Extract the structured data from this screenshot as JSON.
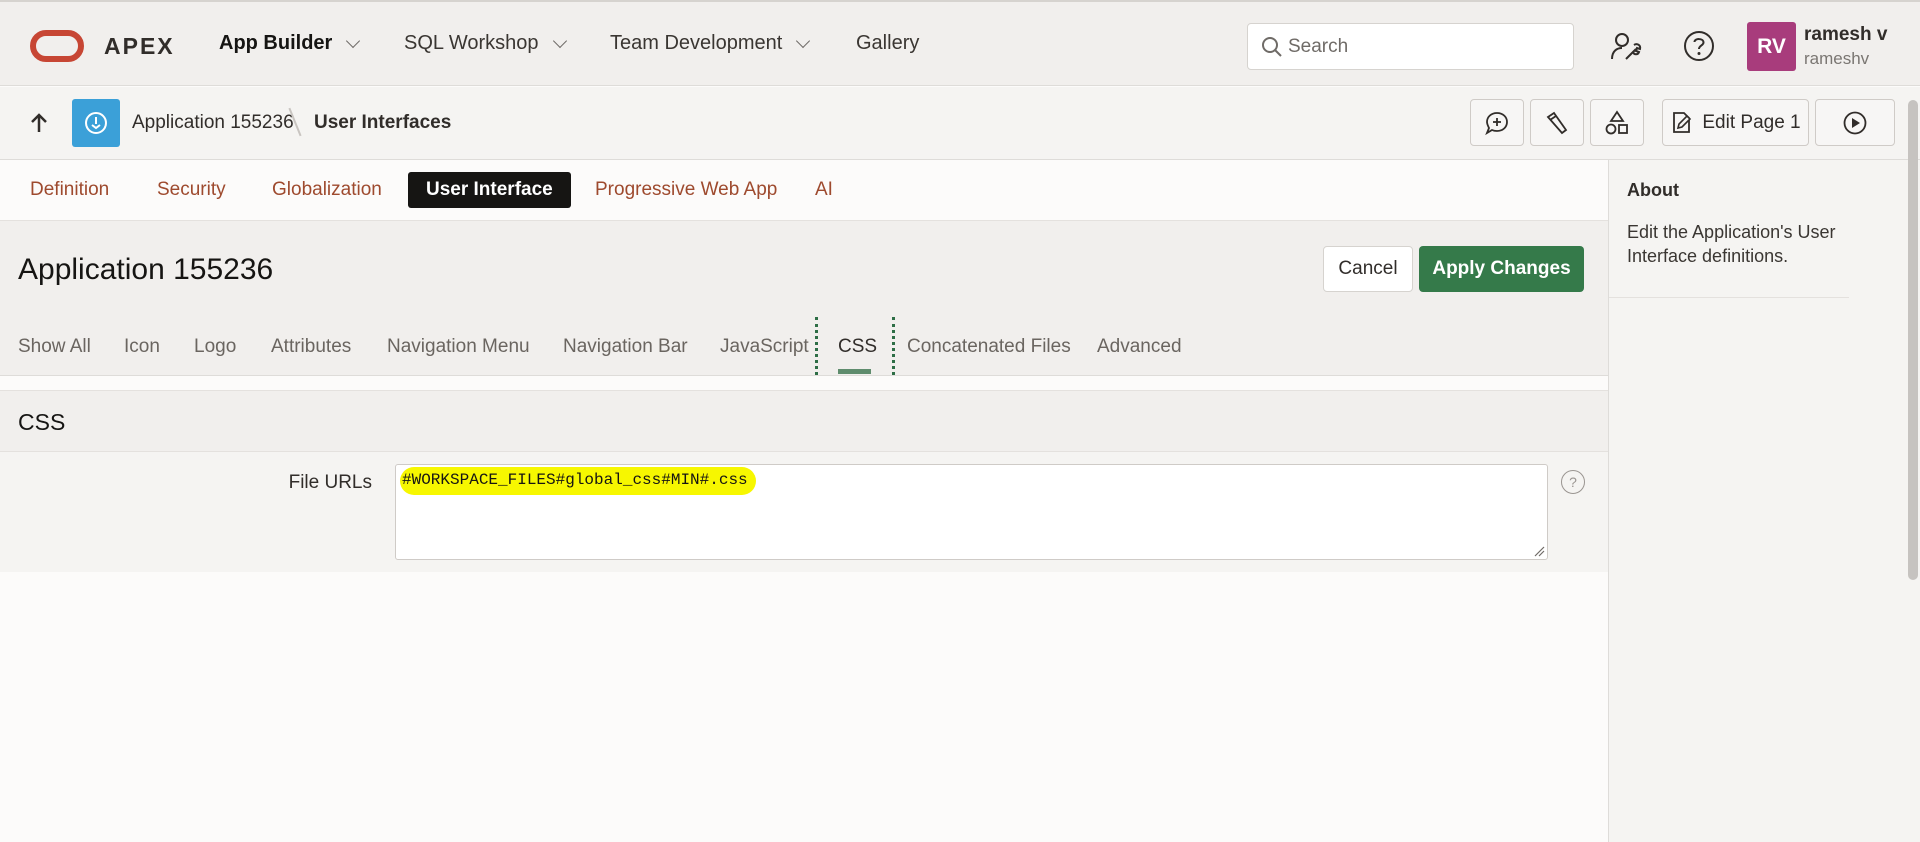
{
  "header": {
    "brand": "APEX",
    "nav": [
      {
        "label": "App Builder"
      },
      {
        "label": "SQL Workshop"
      },
      {
        "label": "Team Development"
      },
      {
        "label": "Gallery"
      }
    ],
    "search_placeholder": "Search",
    "user": {
      "initials": "RV",
      "name": "ramesh v",
      "id": "rameshv"
    }
  },
  "breadcrumb": {
    "app": "Application 155236",
    "current": "User Interfaces"
  },
  "toolbar": {
    "edit_page": "Edit Page 1"
  },
  "main_tabs": [
    {
      "label": "Definition"
    },
    {
      "label": "Security"
    },
    {
      "label": "Globalization"
    },
    {
      "label": "User Interface"
    },
    {
      "label": "Progressive Web App"
    },
    {
      "label": "AI"
    }
  ],
  "page": {
    "title": "Application 155236",
    "cancel_label": "Cancel",
    "apply_label": "Apply Changes"
  },
  "sub_tabs": [
    {
      "label": "Show All"
    },
    {
      "label": "Icon"
    },
    {
      "label": "Logo"
    },
    {
      "label": "Attributes"
    },
    {
      "label": "Navigation Menu"
    },
    {
      "label": "Navigation Bar"
    },
    {
      "label": "JavaScript"
    },
    {
      "label": "CSS"
    },
    {
      "label": "Concatenated Files"
    },
    {
      "label": "Advanced"
    }
  ],
  "region": {
    "title": "CSS",
    "field_label": "File URLs",
    "field_value": "#WORKSPACE_FILES#global_css#MIN#.css",
    "help": "?"
  },
  "about": {
    "title": "About",
    "text": "Edit the Application's User Interface definitions."
  },
  "colors": {
    "accent_green": "#357a4a",
    "brand_red": "#c74634",
    "tab_text": "#9e4a2e",
    "highlight": "#f7f700",
    "avatar": "#a83c7c"
  }
}
